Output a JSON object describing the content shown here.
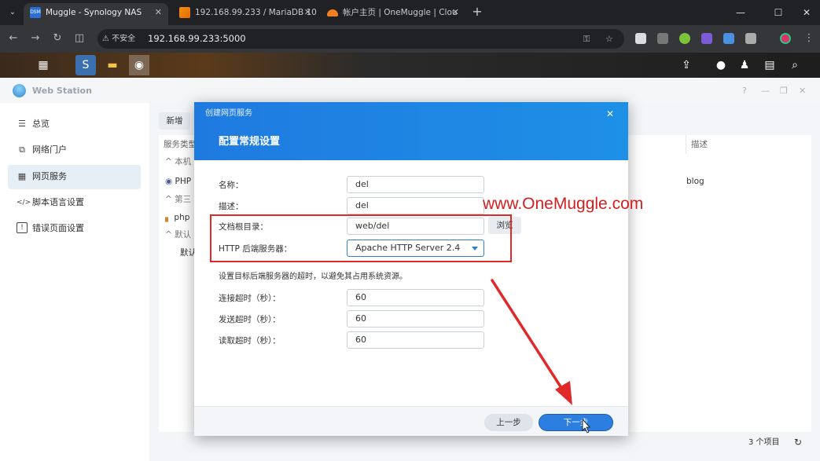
{
  "browser": {
    "tabs": [
      {
        "title": "Muggle - Synology NAS",
        "favicon": "DSM",
        "active": true
      },
      {
        "title": "192.168.99.233 / MariaDB 10",
        "active": false
      },
      {
        "title": "帐户主页 | OneMuggle | Clou",
        "active": false
      }
    ],
    "new_tab": "+",
    "security_label": "不安全",
    "url": "192.168.99.233:5000"
  },
  "window": {
    "title": "Web Station",
    "help": "?",
    "minimize": "—",
    "maximize": "❐",
    "close": "✕"
  },
  "sidebar": {
    "items": [
      {
        "label": "总览",
        "icon": "list-icon",
        "glyph": "☰",
        "active": false
      },
      {
        "label": "网络门户",
        "icon": "portal-icon",
        "glyph": "⧉",
        "active": false
      },
      {
        "label": "网页服务",
        "icon": "grid-icon",
        "glyph": "▦",
        "active": true
      },
      {
        "label": "脚本语言设置",
        "icon": "code-icon",
        "glyph": "</>",
        "active": false
      },
      {
        "label": "错误页面设置",
        "icon": "alert-icon",
        "glyph": "!",
        "active": false
      }
    ]
  },
  "main": {
    "new_button": "新增",
    "columns": {
      "service_type": "服务类型",
      "description": "描述"
    },
    "groups": {
      "native": "本机",
      "third_party": "第三",
      "default": "默认"
    },
    "rows": {
      "php": {
        "name": "PHP",
        "description": "blog"
      },
      "php_third": {
        "name": "php"
      },
      "default": {
        "name": "默认"
      }
    },
    "item_count": "3 个项目"
  },
  "modal": {
    "title": "创建网页服务",
    "subtitle": "配置常规设置",
    "fields": {
      "name": {
        "label": "名称：",
        "value": "del"
      },
      "description": {
        "label": "描述：",
        "value": "del"
      },
      "doc_root": {
        "label": "文档根目录：",
        "value": "web/del"
      },
      "http_backend": {
        "label": "HTTP 后端服务器：",
        "value": "Apache HTTP Server 2.4"
      },
      "connect_timeout": {
        "label": "连接超时（秒）：",
        "value": "60"
      },
      "send_timeout": {
        "label": "发送超时（秒）：",
        "value": "60"
      },
      "read_timeout": {
        "label": "读取超时（秒）：",
        "value": "60"
      }
    },
    "browse": "浏览",
    "timeout_hint": "设置目标后端服务器的超时，以避免其占用系统资源。",
    "prev": "上一步",
    "next": "下一步",
    "close": "✕"
  },
  "watermark": "www.OneMuggle.com",
  "colors": {
    "accent": "#1f7ae0",
    "annotation_red": "#e02929",
    "sidebar_active": "#e6eef6"
  }
}
